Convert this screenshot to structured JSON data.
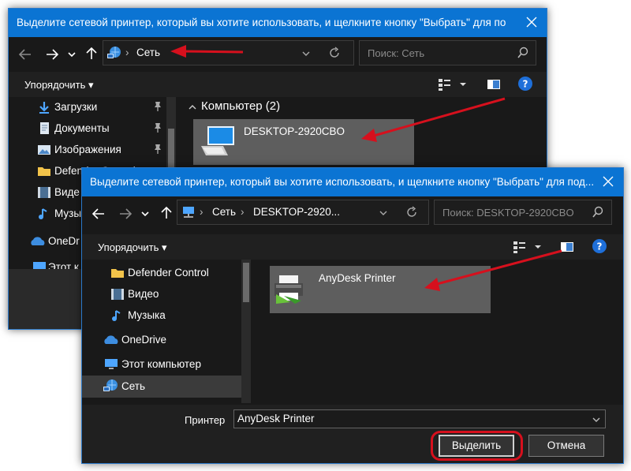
{
  "back_dialog": {
    "title": "Выделите сетевой принтер, который вы хотите использовать, и щелкните кнопку \"Выбрать\" для под...",
    "address": {
      "current": "Сеть"
    },
    "search_placeholder": "Поиск: Сеть",
    "organize_label": "Упорядочить",
    "sidebar": [
      {
        "label": "Загрузки",
        "icon": "download-arrow-icon",
        "pinned": true
      },
      {
        "label": "Документы",
        "icon": "documents-icon",
        "pinned": true
      },
      {
        "label": "Изображения",
        "icon": "pictures-icon",
        "pinned": true
      },
      {
        "label": "Defender Control",
        "icon": "folder-icon"
      },
      {
        "label": "Виде",
        "icon": "video-icon"
      },
      {
        "label": "Музык",
        "icon": "music-icon"
      },
      {
        "label": "OneDr",
        "icon": "onedrive-icon"
      },
      {
        "label": "Этот к",
        "icon": "this-pc-icon"
      }
    ],
    "group_header": "Компьютер (2)",
    "items": [
      {
        "label": "DESKTOP-2920CBO",
        "icon": "computer-icon"
      }
    ]
  },
  "front_dialog": {
    "title": "Выделите сетевой принтер, который вы хотите использовать, и щелкните кнопку \"Выбрать\" для под...",
    "address": {
      "segments": [
        "Сеть",
        "DESKTOP-2920..."
      ]
    },
    "search_placeholder": "Поиск: DESKTOP-2920CBO",
    "organize_label": "Упорядочить",
    "sidebar": [
      {
        "label": "Defender Control",
        "icon": "folder-icon"
      },
      {
        "label": "Видео",
        "icon": "video-icon"
      },
      {
        "label": "Музыка",
        "icon": "music-icon"
      },
      {
        "label": "OneDrive",
        "icon": "onedrive-icon"
      },
      {
        "label": "Этот компьютер",
        "icon": "this-pc-icon"
      },
      {
        "label": "Сеть",
        "icon": "network-icon",
        "selected": true
      }
    ],
    "items": [
      {
        "label": "AnyDesk Printer",
        "icon": "printer-icon"
      }
    ],
    "printer_label": "Принтер",
    "printer_value": "AnyDesk Printer",
    "select_button": "Выделить",
    "cancel_button": "Отмена"
  },
  "colors": {
    "titlebar": "#0b74d3",
    "window_bg": "#191919",
    "tile_selected": "#5e5e5e",
    "annotation_red": "#d6101d",
    "help_blue": "#1e6fd9"
  }
}
